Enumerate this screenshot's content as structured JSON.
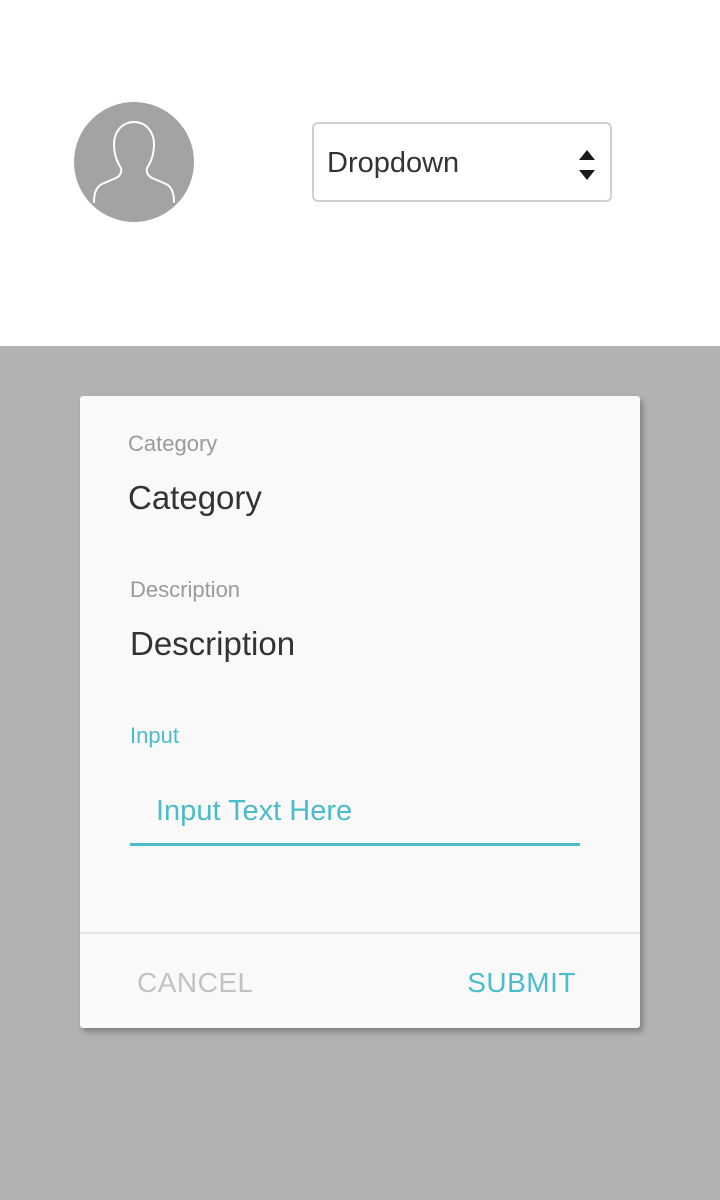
{
  "header": {
    "avatar_icon": "user-silhouette-icon",
    "dropdown": {
      "label": "Dropdown",
      "icon": "sort-arrows-icon"
    }
  },
  "dialog": {
    "category": {
      "label": "Category",
      "value": "Category"
    },
    "description": {
      "label": "Description",
      "value": "Description"
    },
    "input": {
      "label": "Input",
      "placeholder": "Input Text Here"
    },
    "actions": {
      "cancel_label": "CANCEL",
      "submit_label": "SUBMIT"
    }
  },
  "colors": {
    "accent": "#4cbcca",
    "overlay": "#b2b2b2",
    "avatar_bg": "#a3a3a3",
    "dialog_bg": "#f9f9f9"
  }
}
